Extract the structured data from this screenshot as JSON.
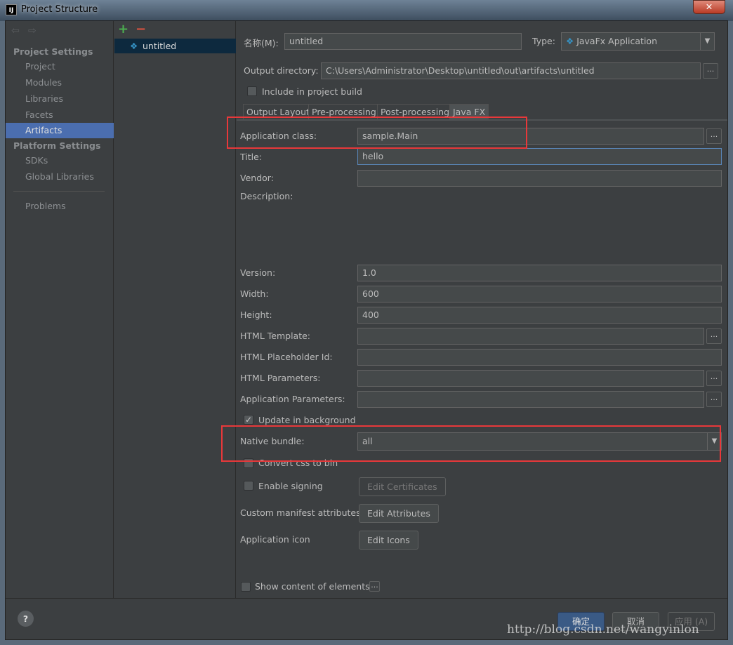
{
  "window": {
    "title": "Project Structure",
    "app_icon": "IJ",
    "close": "✕"
  },
  "sidebar": {
    "back_icon": "⇦",
    "forward_icon": "⇨",
    "sections": [
      {
        "label": "Project Settings"
      },
      {
        "label": "Platform Settings"
      }
    ],
    "items": [
      {
        "label": "Project"
      },
      {
        "label": "Modules"
      },
      {
        "label": "Libraries"
      },
      {
        "label": "Facets"
      },
      {
        "label": "Artifacts",
        "selected": true
      },
      {
        "label": "SDKs"
      },
      {
        "label": "Global Libraries"
      },
      {
        "label": "Problems"
      }
    ]
  },
  "artifacts": {
    "add": "+",
    "remove": "−",
    "items": [
      {
        "label": "untitled"
      }
    ]
  },
  "main": {
    "name_label": "名称(M):",
    "name_value": "untitled",
    "type_label": "Type:",
    "type_value": "JavaFx Application",
    "output_dir_label": "Output directory:",
    "output_dir_value": "C:\\Users\\Administrator\\Desktop\\untitled\\out\\artifacts\\untitled",
    "include_build": "Include in project build",
    "include_build_checked": false,
    "tabs": [
      {
        "label": "Output Layout"
      },
      {
        "label": "Pre-processing"
      },
      {
        "label": "Post-processing"
      },
      {
        "label": "Java FX",
        "selected": true
      }
    ],
    "fields": {
      "app_class": {
        "label": "Application class:",
        "value": "sample.Main"
      },
      "title": {
        "label": "Title:",
        "value": "hello"
      },
      "vendor": {
        "label": "Vendor:",
        "value": ""
      },
      "description": {
        "label": "Description:"
      },
      "version": {
        "label": "Version:",
        "value": "1.0"
      },
      "width": {
        "label": "Width:",
        "value": "600"
      },
      "height": {
        "label": "Height:",
        "value": "400"
      },
      "html_template": {
        "label": "HTML Template:",
        "value": ""
      },
      "html_placeholder": {
        "label": "HTML Placeholder Id:",
        "value": ""
      },
      "html_params": {
        "label": "HTML Parameters:",
        "value": ""
      },
      "app_params": {
        "label": "Application Parameters:",
        "value": ""
      }
    },
    "update_bg": {
      "label": "Update in background",
      "checked": true
    },
    "native_bundle": {
      "label": "Native bundle:",
      "value": "all"
    },
    "convert_css": {
      "label": "Convert css to bin",
      "checked": false
    },
    "enable_signing": {
      "label": "Enable signing",
      "checked": false,
      "button": "Edit Certificates"
    },
    "manifest": {
      "label": "Custom manifest attributes",
      "button": "Edit  Attributes"
    },
    "app_icon": {
      "label": "Application icon",
      "button": "Edit Icons"
    },
    "show_content": {
      "label": "Show content of elements",
      "checked": false
    },
    "browse": "..."
  },
  "footer": {
    "help": "?",
    "ok": "确定",
    "cancel": "取消",
    "apply": "应用 (A)"
  },
  "watermark": "http://blog.csdn.net/wangyinlon",
  "colors": {
    "highlight_box": "#e8383a",
    "selection": "#4b6eaf",
    "background": "#3c3f41"
  }
}
